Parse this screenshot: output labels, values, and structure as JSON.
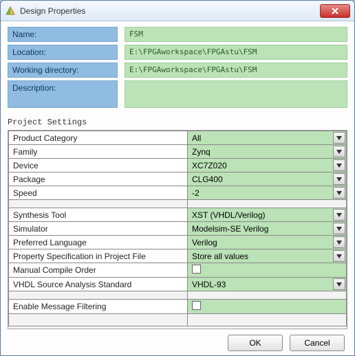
{
  "window": {
    "title": "Design Properties"
  },
  "form": {
    "name_label": "Name:",
    "name_value": "FSM",
    "location_label": "Location:",
    "location_value": "E:\\FPGAworkspace\\FPGAstu\\FSM",
    "wd_label": "Working directory:",
    "wd_value": "E:\\FPGAworkspace\\FPGAstu\\FSM",
    "desc_label": "Description:",
    "desc_value": ""
  },
  "section": {
    "title": "Project Settings"
  },
  "rows": {
    "r0": {
      "k": "Product Category",
      "v": "All",
      "dd": true
    },
    "r1": {
      "k": "Family",
      "v": "Zynq",
      "dd": true
    },
    "r2": {
      "k": "Device",
      "v": "XC7Z020",
      "dd": true
    },
    "r3": {
      "k": "Package",
      "v": "CLG400",
      "dd": true
    },
    "r4": {
      "k": "Speed",
      "v": "-2",
      "dd": true
    },
    "r5": {
      "k": "Synthesis Tool",
      "v": "XST (VHDL/Verilog)",
      "dd": true
    },
    "r6": {
      "k": "Simulator",
      "v": "Modelsim-SE Verilog",
      "dd": true
    },
    "r7": {
      "k": "Preferred Language",
      "v": "Verilog",
      "dd": true
    },
    "r8": {
      "k": "Property Specification in Project File",
      "v": "Store all values",
      "dd": true
    },
    "r9": {
      "k": "Manual Compile Order",
      "v": "",
      "chk": true
    },
    "r10": {
      "k": "VHDL Source Analysis Standard",
      "v": "VHDL-93",
      "dd": true
    },
    "r11": {
      "k": "Enable Message Filtering",
      "v": "",
      "chk": true
    }
  },
  "buttons": {
    "ok": "OK",
    "cancel": "Cancel"
  }
}
